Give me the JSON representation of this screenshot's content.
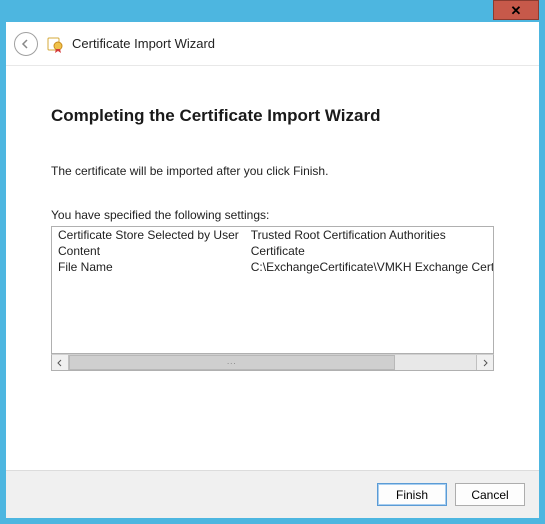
{
  "titlebar": {
    "title": "Certificate Import Wizard"
  },
  "close_glyph": "✕",
  "content": {
    "heading": "Completing the Certificate Import Wizard",
    "info_line": "The certificate will be imported after you click Finish.",
    "settings_label": "You have specified the following settings:",
    "rows": [
      {
        "label": "Certificate Store Selected by User",
        "value": "Trusted Root Certification Authorities"
      },
      {
        "label": "Content",
        "value": "Certificate"
      },
      {
        "label": "File Name",
        "value": "C:\\ExchangeCertificate\\VMKH Exchange Certificate.c"
      }
    ]
  },
  "footer": {
    "finish": "Finish",
    "cancel": "Cancel"
  }
}
